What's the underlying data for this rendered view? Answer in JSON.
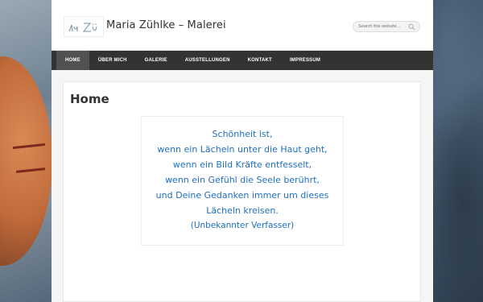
{
  "site": {
    "title": "Maria Zühlke – Malerei",
    "logo_text": "hu Zü"
  },
  "search": {
    "placeholder": "Search this website..."
  },
  "nav": {
    "items": [
      {
        "label": "Home",
        "active": true
      },
      {
        "label": "Über mich"
      },
      {
        "label": "Galerie"
      },
      {
        "label": "Ausstellungen"
      },
      {
        "label": "Kontakt"
      },
      {
        "label": "Impressum"
      }
    ]
  },
  "page": {
    "title": "Home",
    "quote_lines": [
      "Schönheit ist,",
      "wenn ein Lächeln unter die Haut geht,",
      "wenn ein Bild Kräfte entfesselt,",
      "wenn ein Gefühl die Seele berührt,",
      "und Deine Gedanken immer um dieses",
      "Lächeln kreisen."
    ],
    "quote_author": "(Unbekannter Verfasser)"
  },
  "colors": {
    "quote_text": "#1f6fc0",
    "nav_bg": "#333333",
    "nav_active": "#515151"
  }
}
